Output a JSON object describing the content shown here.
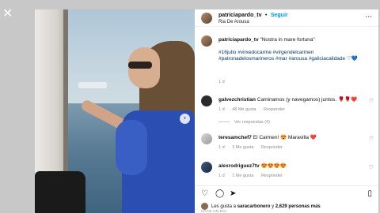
{
  "close_icon": "close-icon",
  "post": {
    "username": "patriciapardo_tv",
    "separator": "•",
    "follow_label": "Seguir",
    "location": "Ria De Arousa",
    "more_icon": "more-icon"
  },
  "caption": {
    "username": "patriciapardo_tv",
    "text": "\"Nostra in mare fortuna\"",
    "hashtags_line1": "#16julio #virxedocarme #virgendelcarmen",
    "hashtags_line2": "#patronadelosmarineros #mar #arousa #galiciacalidade ♡💙",
    "time": "1 d"
  },
  "comments": [
    {
      "username": "galvezchristian",
      "text": "Caminamos (y navegamos) juntos. 🌹🌹❤️",
      "time": "1 d",
      "likes": "48 Me gusta",
      "reply": "Responder",
      "view_replies": "Ver respuestas (4)"
    },
    {
      "username": "teresamchef7",
      "text": "El Carmen! 😍 Maravilla ❤️",
      "time": "1 d",
      "likes": "3 Me gusta",
      "reply": "Responder"
    },
    {
      "username": "alexrodriguez7tv",
      "text": "😍😍😍😍",
      "time": "1 d",
      "likes": "1 Me gusta",
      "reply": "Responder"
    }
  ],
  "actions": {
    "like_icon": "heart-icon",
    "comment_icon": "comment-icon",
    "share_icon": "share-icon",
    "save_icon": "bookmark-icon"
  },
  "likes_prefix": "Les gusta a",
  "likes_user": "saracarbonero",
  "likes_mid": "y",
  "likes_count": "2,629 personas más",
  "posted_ago": "HACE UN DÍA",
  "colors": {
    "accent": "#0095f6",
    "dress": "#2b4eb3",
    "background": "#c8c8c8"
  }
}
